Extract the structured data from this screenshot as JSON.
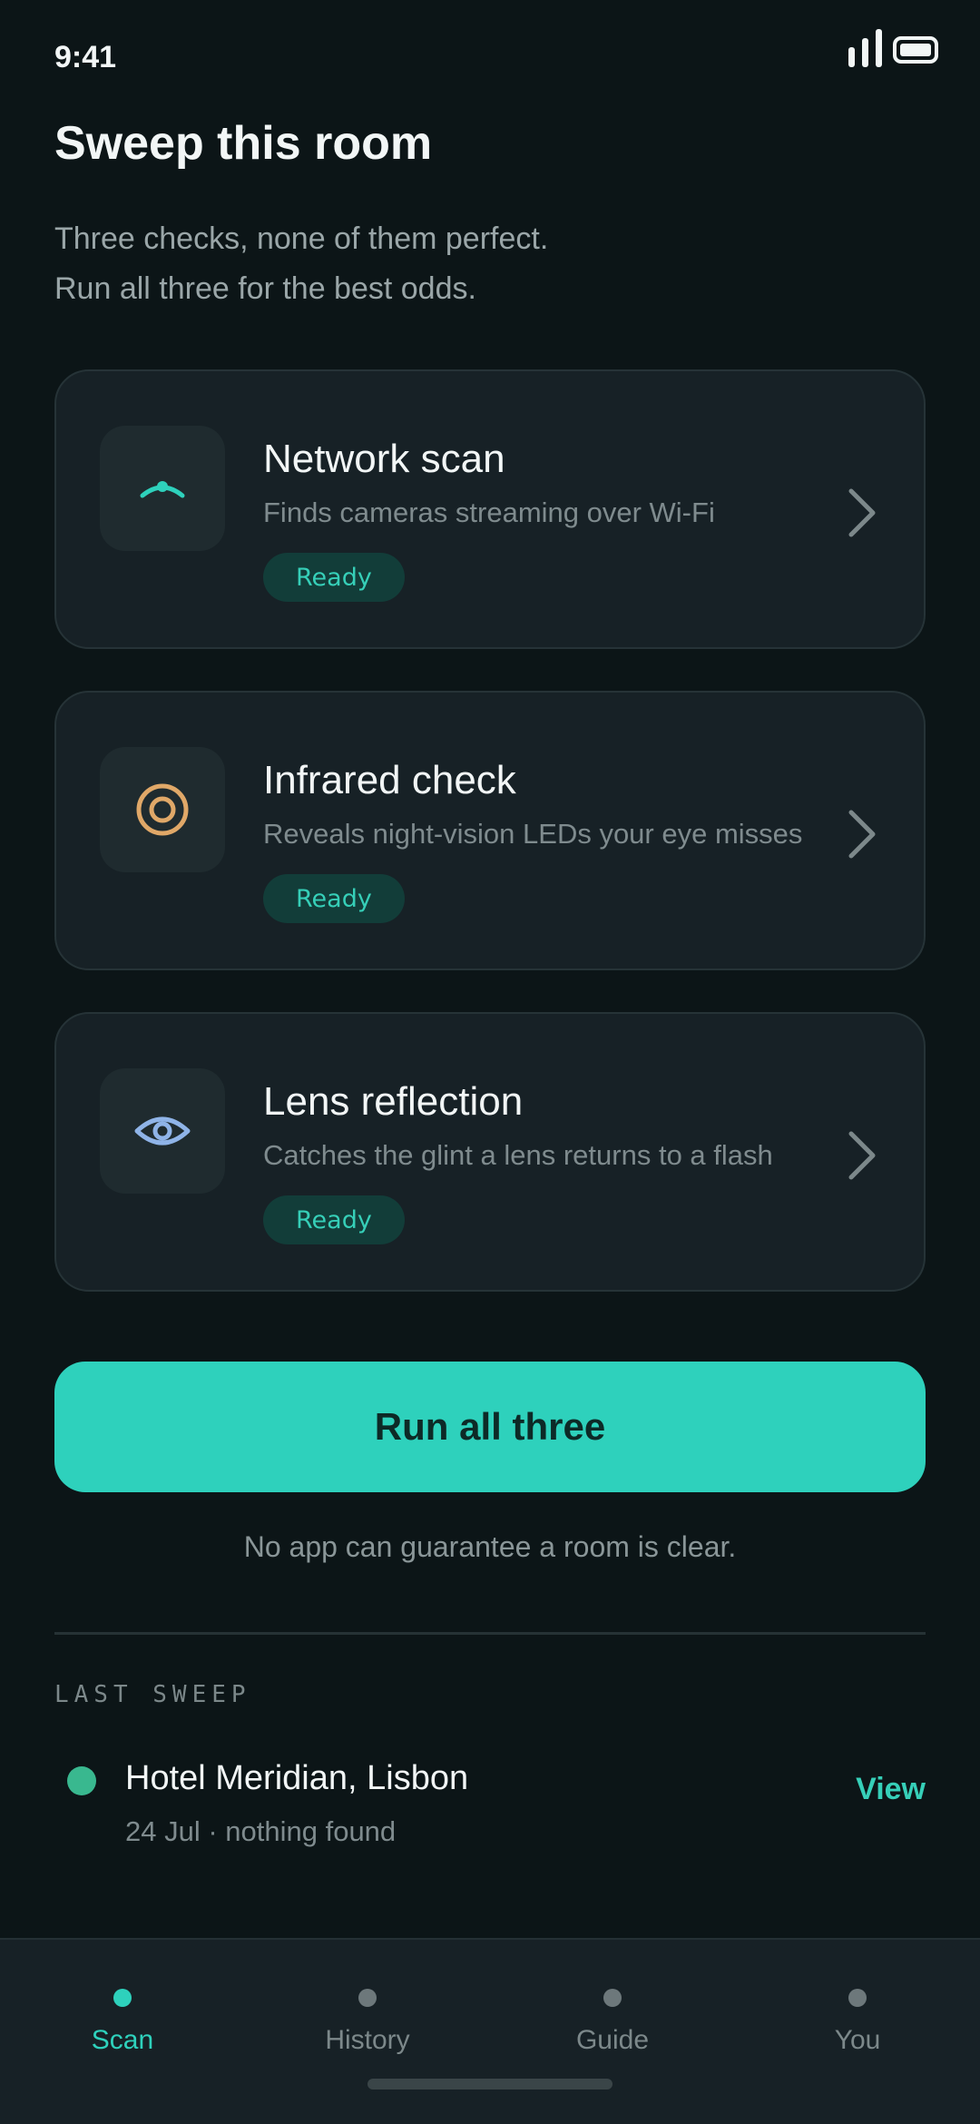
{
  "status": {
    "time": "9:41"
  },
  "header": {
    "title": "Sweep this room",
    "subtitle_line1": "Three checks, none of them perfect.",
    "subtitle_line2": "Run all three for the best odds."
  },
  "checks": [
    {
      "name": "Network scan",
      "description": "Finds cameras streaming over Wi-Fi",
      "status": "Ready",
      "icon": "wifi-icon",
      "icon_color": "#2ed1bc"
    },
    {
      "name": "Infrared check",
      "description": "Reveals night-vision LEDs your eye misses",
      "status": "Ready",
      "icon": "target-icon",
      "icon_color": "#e0a868"
    },
    {
      "name": "Lens reflection",
      "description": "Catches the glint a lens returns to a flash",
      "status": "Ready",
      "icon": "eye-icon",
      "icon_color": "#8fb4e8"
    }
  ],
  "primary_action": {
    "label": "Run all three"
  },
  "disclaimer": "No app can guarantee a room is clear.",
  "last_sweep": {
    "section_label": "LAST SWEEP",
    "location": "Hotel Meridian, Lisbon",
    "meta": "24 Jul · nothing found",
    "action_label": "View",
    "dot_color": "#39b88f"
  },
  "tabs": [
    {
      "label": "Scan",
      "active": true
    },
    {
      "label": "History",
      "active": false
    },
    {
      "label": "Guide",
      "active": false
    },
    {
      "label": "You",
      "active": false
    }
  ],
  "colors": {
    "accent": "#2ed1bc",
    "background": "#0c1517",
    "card": "#172126"
  }
}
